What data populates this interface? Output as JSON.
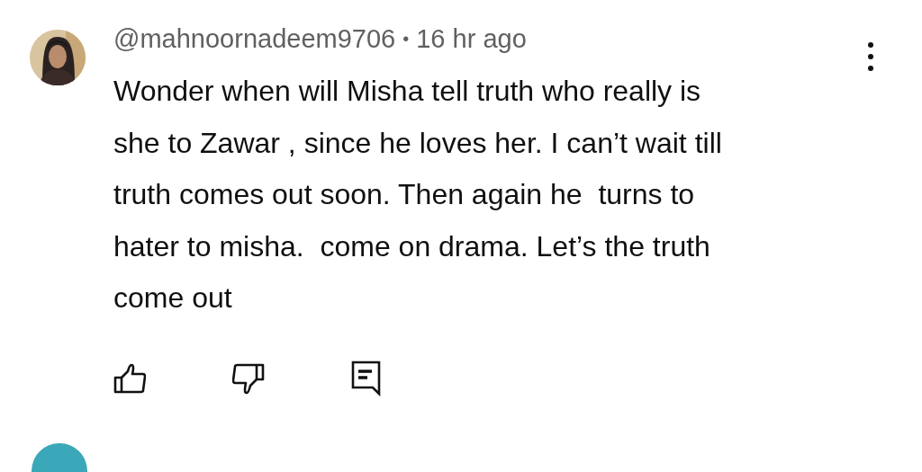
{
  "comment": {
    "author": "@mahnoornadeem9706",
    "separator": "•",
    "time": "16 hr ago",
    "body_lines": [
      "Wonder when will Misha tell truth who really is",
      "she to Zawar , since he loves her. I can’t wait till",
      "truth comes out soon. Then again he  turns to",
      "hater to misha.  come on drama. Let’s the truth",
      "come out"
    ]
  }
}
